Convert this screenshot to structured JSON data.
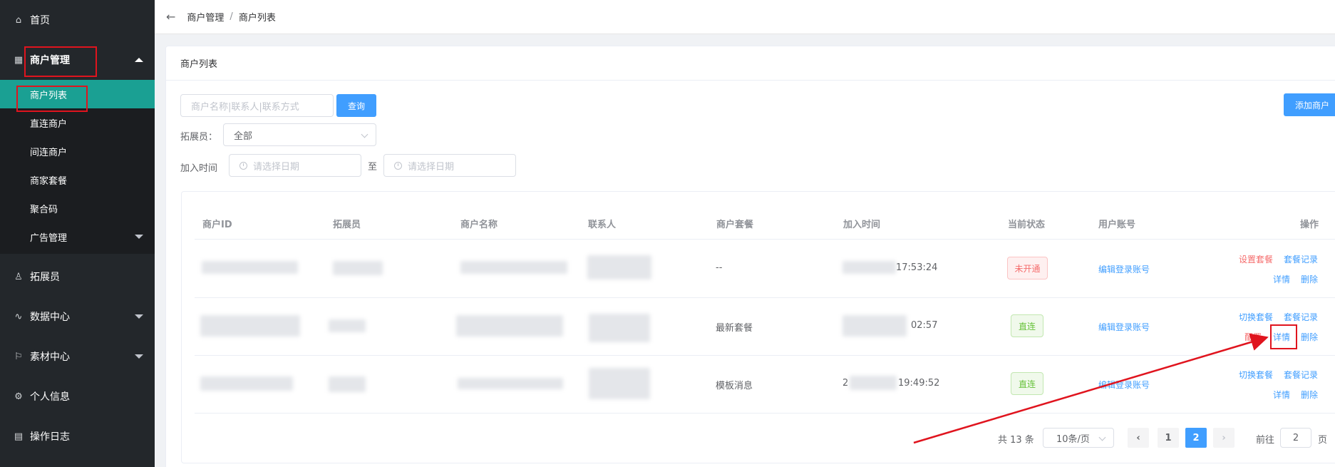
{
  "sidebar": {
    "home": "首页",
    "merchant_mgmt": "商户管理",
    "sub_items": [
      "商户列表",
      "直连商户",
      "间连商户",
      "商家套餐",
      "聚合码",
      "广告管理"
    ],
    "expander": "拓展员",
    "data_center": "数据中心",
    "material_center": "素材中心",
    "personal_info": "个人信息",
    "op_log": "操作日志"
  },
  "breadcrumb": {
    "parent": "商户管理",
    "sep": "/",
    "current": "商户列表"
  },
  "card": {
    "title": "商户列表"
  },
  "filters": {
    "search_placeholder": "商户名称|联系人|联系方式",
    "query_btn": "查询",
    "add_btn": "添加商户",
    "expander_label": "拓展员：",
    "expander_value": "全部",
    "join_time_label": "加入时间",
    "date_placeholder": "请选择日期",
    "to": "至"
  },
  "table": {
    "headers": [
      "商户ID",
      "拓展员",
      "商户名称",
      "联系人",
      "商户套餐",
      "加入时间",
      "当前状态",
      "用户账号",
      "操作"
    ],
    "rows": [
      {
        "package": "--",
        "time": "17:53:24",
        "status": "未开通",
        "account": "编辑登录账号",
        "actions": [
          "设置套餐",
          "套餐记录",
          "详情",
          "删除"
        ]
      },
      {
        "package": "最新套餐",
        "time": "02:57",
        "status": "直连",
        "account": "编辑登录账号",
        "actions": [
          "切换套餐",
          "套餐记录",
          "配置",
          "详情",
          "删除"
        ]
      },
      {
        "package": "模板消息",
        "time_prefix": "2",
        "time": "19:49:52",
        "status": "直连",
        "account": "编辑登录账号",
        "actions": [
          "切换套餐",
          "套餐记录",
          "详情",
          "删除"
        ]
      }
    ]
  },
  "pagination": {
    "total": "共 13 条",
    "page_size": "10条/页",
    "pages": [
      "1",
      "2"
    ],
    "goto_label": "前往",
    "goto_value": "2",
    "page_unit": "页"
  },
  "colors": {
    "primary": "#409eff",
    "sidebar": "#23272b",
    "active": "#1aa093",
    "danger": "#f56c6c",
    "success": "#67c23a",
    "annotation": "#e0141e"
  }
}
